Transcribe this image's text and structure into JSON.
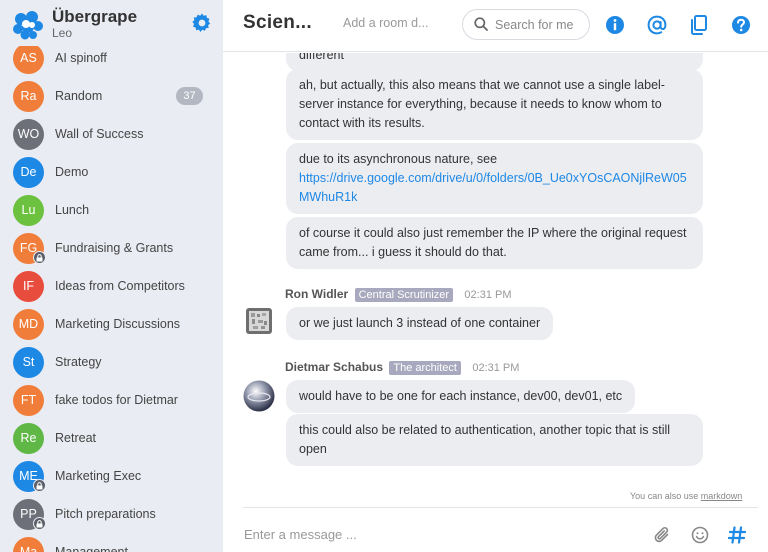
{
  "app": {
    "org_name": "Übergrape",
    "user_name": "Leo",
    "brand_color": "#1e88e5"
  },
  "sidebar": {
    "rooms": [
      {
        "initials": "AS",
        "name": "AI spinoff",
        "color": "#f07e3a",
        "locked": false,
        "badge": null
      },
      {
        "initials": "Ra",
        "name": "Random",
        "color": "#f07e3a",
        "locked": false,
        "badge": "37"
      },
      {
        "initials": "WO",
        "name": "Wall of Success",
        "color": "#6e7079",
        "locked": false,
        "badge": null
      },
      {
        "initials": "De",
        "name": "Demo",
        "color": "#1e88e5",
        "locked": false,
        "badge": null
      },
      {
        "initials": "Lu",
        "name": "Lunch",
        "color": "#6cc13f",
        "locked": false,
        "badge": null
      },
      {
        "initials": "FG",
        "name": "Fundraising & Grants",
        "color": "#f07e3a",
        "locked": true,
        "badge": null
      },
      {
        "initials": "IF",
        "name": "Ideas from Competitors",
        "color": "#e84c3d",
        "locked": false,
        "badge": null
      },
      {
        "initials": "MD",
        "name": "Marketing Discussions",
        "color": "#f07e3a",
        "locked": false,
        "badge": null
      },
      {
        "initials": "St",
        "name": "Strategy",
        "color": "#1e88e5",
        "locked": false,
        "badge": null
      },
      {
        "initials": "FT",
        "name": "fake todos for Dietmar",
        "color": "#f07e3a",
        "locked": false,
        "badge": null
      },
      {
        "initials": "Re",
        "name": "Retreat",
        "color": "#5fb845",
        "locked": false,
        "badge": null
      },
      {
        "initials": "ME",
        "name": "Marketing Exec",
        "color": "#1e88e5",
        "locked": true,
        "badge": null
      },
      {
        "initials": "PP",
        "name": "Pitch preparations",
        "color": "#6e7079",
        "locked": true,
        "badge": null
      },
      {
        "initials": "Ma",
        "name": "Management",
        "color": "#f07e3a",
        "locked": false,
        "badge": null
      }
    ]
  },
  "header": {
    "room_title": "Scien...",
    "room_description_placeholder": "Add a room d...",
    "search_placeholder": "Search for me"
  },
  "messages": {
    "m1": "different",
    "m2": "ah, but actually, this also means that we cannot use a single label-server instance for everything, because it needs to know whom to contact with its results.",
    "m3_text": "due to its asynchronous nature, see",
    "m3_link": "https://drive.google.com/drive/u/0/folders/0B_Ue0xYOsCAONjlReW05MWhuR1k",
    "m4": "of course it could also just remember the IP where the original request came from... i guess it should do that.",
    "ron_name": "Ron Widler",
    "ron_role": "Central Scrutinizer",
    "ron_time": "02:31 PM",
    "m5": "or we just launch 3 instead of one container",
    "dietmar_name": "Dietmar Schabus",
    "dietmar_role": "The architect",
    "dietmar_time": "02:31 PM",
    "m6": "would have to be one for each instance, dev00, dev01, etc",
    "m7": "this could also be related to authentication, another topic that is still open"
  },
  "composer": {
    "hint_text": "You can also use",
    "hint_link": "markdown",
    "placeholder": "Enter a message ..."
  }
}
